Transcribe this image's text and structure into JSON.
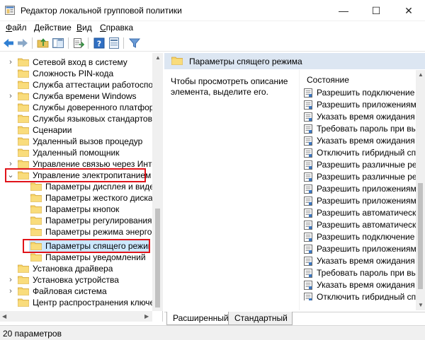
{
  "window": {
    "title": "Редактор локальной групповой политики",
    "minimize": "—",
    "maximize": "☐",
    "close": "✕"
  },
  "menu": [
    {
      "prefix": "",
      "underline": "Ф",
      "rest": "айл"
    },
    {
      "prefix": "",
      "underline": "Д",
      "rest": "ействие"
    },
    {
      "prefix": "",
      "underline": "В",
      "rest": "ид"
    },
    {
      "prefix": "",
      "underline": "С",
      "rest": "правка"
    }
  ],
  "tree": {
    "items": [
      {
        "label": "Сетевой вход в систему",
        "expander": "›"
      },
      {
        "label": "Сложность PIN-кода",
        "expander": ""
      },
      {
        "label": "Служба аттестации работоспособ",
        "expander": ""
      },
      {
        "label": "Служба времени Windows",
        "expander": "›"
      },
      {
        "label": "Службы доверенного платформен",
        "expander": ""
      },
      {
        "label": "Службы языковых стандартов",
        "expander": ""
      },
      {
        "label": "Сценарии",
        "expander": ""
      },
      {
        "label": "Удаленный вызов процедур",
        "expander": ""
      },
      {
        "label": "Удаленный помощник",
        "expander": ""
      },
      {
        "label": "Управление связью через Интерн",
        "expander": "›"
      },
      {
        "label": "Управление электропитанием",
        "expander": "⌄"
      },
      {
        "label": "Параметры дисплея и видео",
        "expander": "",
        "child": true
      },
      {
        "label": "Параметры жесткого диска",
        "expander": "",
        "child": true
      },
      {
        "label": "Параметры кнопок",
        "expander": "",
        "child": true
      },
      {
        "label": "Параметры регулирования мо",
        "expander": "",
        "child": true
      },
      {
        "label": "Параметры режима энергосбе",
        "expander": "",
        "child": true
      },
      {
        "label": "Параметры спящего режима",
        "expander": "",
        "child": true,
        "selected": true
      },
      {
        "label": "Параметры уведомлений",
        "expander": "",
        "child": true
      },
      {
        "label": "Установка драйвера",
        "expander": ""
      },
      {
        "label": "Установка устройства",
        "expander": "›"
      },
      {
        "label": "Файловая система",
        "expander": "›"
      },
      {
        "label": "Центр распространения ключей",
        "expander": ""
      }
    ]
  },
  "right": {
    "header_title": "Параметры спящего режима",
    "description": "Чтобы просмотреть описание элемента, выделите его.",
    "column_header": "Состояние",
    "items": [
      "Разрешить подключение к с",
      "Разрешить приложениям п",
      "Указать время ожидания дл",
      "Требовать пароль при выхо",
      "Указать время ожидания дл",
      "Отключить гибридный спящ",
      "Разрешить различные режи",
      "Разрешить различные режи",
      "Разрешить приложениям п",
      "Разрешить приложениям п",
      "Разрешить автоматический",
      "Разрешить автоматический",
      "Разрешить подключение к с",
      "Разрешить приложениям п",
      "Указать время ожидания дл",
      "Требовать пароль при выхо",
      "Указать время ожидания дл",
      "Отключить гибридный спящ"
    ]
  },
  "tabs": {
    "extended": "Расширенный",
    "standard": "Стандартный"
  },
  "status": {
    "text": "20 параметров"
  },
  "colors": {
    "selection_outline": "#e0141a",
    "header_bg": "#dce6f2",
    "selected_row": "#cce8ff"
  }
}
